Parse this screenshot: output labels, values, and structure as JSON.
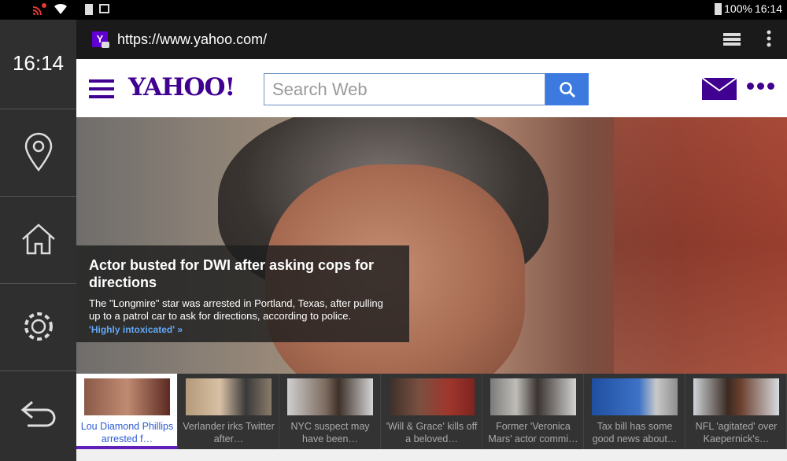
{
  "status": {
    "battery": "100%",
    "time": "16:14"
  },
  "sidebar": {
    "clock": "16:14"
  },
  "browser": {
    "favicon": "Y",
    "url": "https://www.yahoo.com/"
  },
  "header": {
    "logo": "YAHOO!",
    "search_placeholder": "Search Web"
  },
  "hero": {
    "title": "Actor busted for DWI after asking cops for directions",
    "summary": "The \"Longmire\" star was arrested in Portland, Texas, after pulling up to a patrol car to ask for directions, according to police.",
    "link": "'Highly intoxicated' »"
  },
  "carousel": [
    {
      "title": "Lou Diamond Phillips arrested f…"
    },
    {
      "title": "Verlander irks Twitter after…"
    },
    {
      "title": "NYC suspect may have been…"
    },
    {
      "title": "'Will & Grace' kills off a beloved…"
    },
    {
      "title": "Former 'Veronica Mars' actor commi…"
    },
    {
      "title": "Tax bill has some good news about…"
    },
    {
      "title": "NFL 'agitated' over Kaepernick's…"
    }
  ],
  "colors": {
    "brand": "#400090",
    "search_button": "#3c7ae0",
    "link": "#62a8f5"
  }
}
